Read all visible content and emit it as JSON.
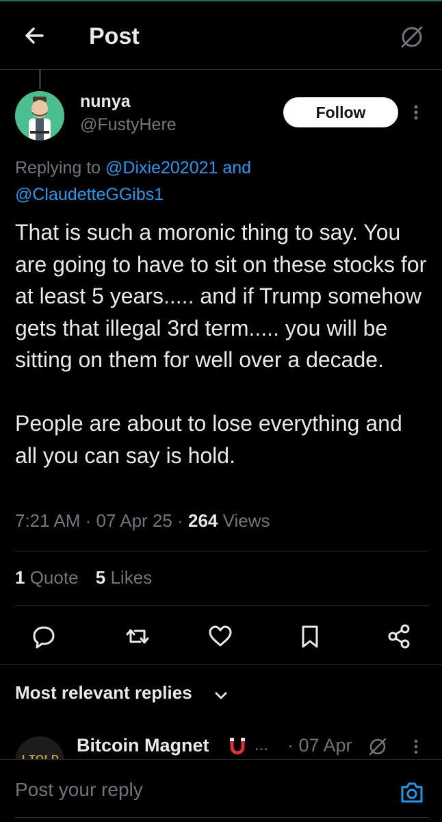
{
  "header": {
    "title": "Post",
    "back_icon": "arrow-left-icon",
    "grok_icon": "grok-icon"
  },
  "post": {
    "author_name": "nunya",
    "author_handle": "@FustyHere",
    "follow_label": "Follow",
    "replying_prefix": "Replying to",
    "replying_mention_1": "@Dixie202021",
    "replying_joiner": "and",
    "replying_mention_2": "@ClaudetteGGibs1",
    "body": "That is such a moronic thing to say. You are going to have to sit on these stocks for at least 5 years..... and if Trump somehow gets that illegal 3rd term..... you will be sitting on them for well over a decade.\n\nPeople are about to lose everything and all you can say is hold.",
    "time": "7:21 AM",
    "date": "07 Apr 25",
    "separator": "·",
    "views_count": "264",
    "views_label": "Views",
    "quotes_count": "1",
    "quotes_label": "Quote",
    "likes_count": "5",
    "likes_label": "Likes"
  },
  "actions": [
    "reply-icon",
    "repost-icon",
    "like-icon",
    "bookmark-icon",
    "share-icon"
  ],
  "replies": {
    "sort_label": "Most relevant replies",
    "first": {
      "avatar_text": "I TOLD",
      "name": "Bitcoin Magnet",
      "name_suffix": "...",
      "date": "· 07 Apr"
    }
  },
  "composer": {
    "placeholder": "Post your reply"
  },
  "colors": {
    "background": "#000000",
    "text": "#e7e9ea",
    "muted": "#71767b",
    "accent": "#1d9bf0",
    "divider": "#2f3336"
  }
}
